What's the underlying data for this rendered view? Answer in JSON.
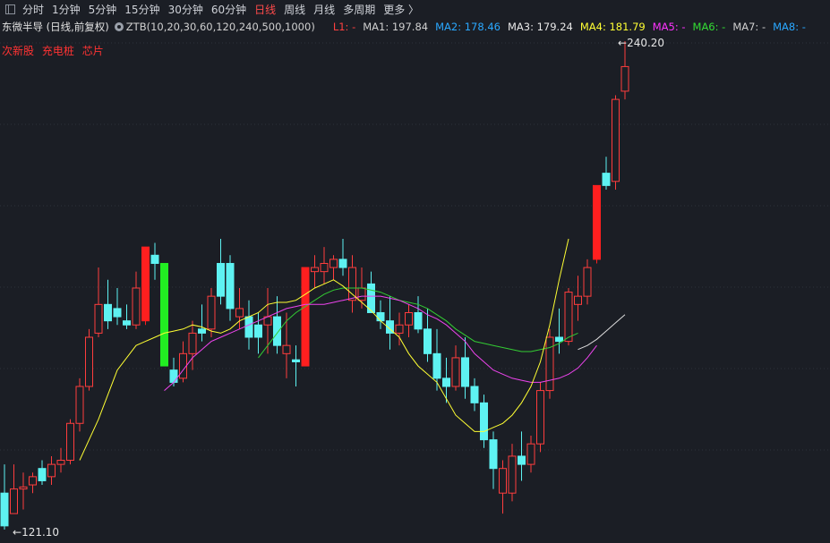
{
  "toolbar": {
    "tabs": [
      "分时",
      "1分钟",
      "5分钟",
      "15分钟",
      "30分钟",
      "60分钟",
      "日线",
      "周线",
      "月线",
      "多周期",
      "更多 〉"
    ],
    "active_index": 6
  },
  "info": {
    "stock_name": "东微半导 (日线,前复权)",
    "indicator": "ZTB(10,20,30,60,120,240,500,1000)",
    "ma_items": [
      {
        "label": "L1: -",
        "color": "#ff4040"
      },
      {
        "label": "MA1: 197.84",
        "color": "#cfcfcf"
      },
      {
        "label": "MA2: 178.46",
        "color": "#2aa8ff"
      },
      {
        "label": "MA3: 179.24",
        "color": "#e8e8e8"
      },
      {
        "label": "MA4: 181.79",
        "color": "#ffff33"
      },
      {
        "label": "MA5: -",
        "color": "#ff33ff"
      },
      {
        "label": "MA6: -",
        "color": "#33dd33"
      },
      {
        "label": "MA7: -",
        "color": "#cfcfcf"
      },
      {
        "label": "MA8: -",
        "color": "#2aa8ff"
      }
    ]
  },
  "tags": [
    "次新股",
    "充电桩",
    "芯片"
  ],
  "high_label": "240.20",
  "low_label": "121.10",
  "colors": {
    "up": "#ff3d3d",
    "down": "#5ef2f2",
    "limit_up": "#ff1f1f",
    "limit_down": "#22ee22",
    "ma_yellow": "#ffff33",
    "ma_magenta": "#ee44ee",
    "ma_green": "#33cc33",
    "ma_white": "#dddddd",
    "grid": "#2c313b"
  },
  "chart_data": {
    "type": "candlestick",
    "price_range": [
      121.1,
      240.2
    ],
    "candles": [
      {
        "o": 130.0,
        "h": 137.0,
        "l": 121.1,
        "c": 122.0,
        "t": "down"
      },
      {
        "o": 125.0,
        "h": 137.0,
        "l": 125.0,
        "c": 131.0,
        "t": "up"
      },
      {
        "o": 131.0,
        "h": 135.0,
        "l": 126.0,
        "c": 131.5,
        "t": "up"
      },
      {
        "o": 132.0,
        "h": 135.0,
        "l": 130.0,
        "c": 134.0,
        "t": "up"
      },
      {
        "o": 133.0,
        "h": 138.0,
        "l": 132.0,
        "c": 136.0,
        "t": "down"
      },
      {
        "o": 134.0,
        "h": 139.0,
        "l": 132.0,
        "c": 137.0,
        "t": "up"
      },
      {
        "o": 137.0,
        "h": 141.0,
        "l": 135.0,
        "c": 138.0,
        "t": "up"
      },
      {
        "o": 138.0,
        "h": 148.0,
        "l": 137.0,
        "c": 147.0,
        "t": "up"
      },
      {
        "o": 147.0,
        "h": 158.0,
        "l": 145.0,
        "c": 156.0,
        "t": "up"
      },
      {
        "o": 156.0,
        "h": 170.0,
        "l": 155.0,
        "c": 168.0,
        "t": "up"
      },
      {
        "o": 169.0,
        "h": 185.0,
        "l": 168.0,
        "c": 176.0,
        "t": "up"
      },
      {
        "o": 176.0,
        "h": 182.0,
        "l": 170.0,
        "c": 172.0,
        "t": "down"
      },
      {
        "o": 175.0,
        "h": 180.0,
        "l": 171.0,
        "c": 173.0,
        "t": "down"
      },
      {
        "o": 172.0,
        "h": 176.0,
        "l": 170.0,
        "c": 171.0,
        "t": "down"
      },
      {
        "o": 171.0,
        "h": 184.0,
        "l": 170.0,
        "c": 180.0,
        "t": "up"
      },
      {
        "o": 172.0,
        "h": 190.0,
        "l": 171.0,
        "c": 190.0,
        "t": "limit_up"
      },
      {
        "o": 188.0,
        "h": 191.0,
        "l": 182.0,
        "c": 186.0,
        "t": "down"
      },
      {
        "o": 186.0,
        "h": 186.0,
        "l": 161.0,
        "c": 161.0,
        "t": "limit_down"
      },
      {
        "o": 160.0,
        "h": 163.0,
        "l": 156.0,
        "c": 157.0,
        "t": "down"
      },
      {
        "o": 158.0,
        "h": 167.0,
        "l": 157.0,
        "c": 164.0,
        "t": "up"
      },
      {
        "o": 164.0,
        "h": 172.0,
        "l": 160.0,
        "c": 169.0,
        "t": "up"
      },
      {
        "o": 169.0,
        "h": 176.0,
        "l": 167.0,
        "c": 170.0,
        "t": "down"
      },
      {
        "o": 170.0,
        "h": 180.0,
        "l": 168.0,
        "c": 178.0,
        "t": "up"
      },
      {
        "o": 178.0,
        "h": 192.0,
        "l": 176.0,
        "c": 186.0,
        "t": "down"
      },
      {
        "o": 186.0,
        "h": 188.0,
        "l": 172.0,
        "c": 175.0,
        "t": "down"
      },
      {
        "o": 175.0,
        "h": 180.0,
        "l": 170.0,
        "c": 173.0,
        "t": "up"
      },
      {
        "o": 173.0,
        "h": 177.0,
        "l": 165.0,
        "c": 168.0,
        "t": "down"
      },
      {
        "o": 168.0,
        "h": 174.0,
        "l": 164.0,
        "c": 171.0,
        "t": "down"
      },
      {
        "o": 171.0,
        "h": 180.0,
        "l": 164.0,
        "c": 173.0,
        "t": "up"
      },
      {
        "o": 173.0,
        "h": 178.0,
        "l": 164.0,
        "c": 166.0,
        "t": "down"
      },
      {
        "o": 166.0,
        "h": 174.0,
        "l": 158.0,
        "c": 164.0,
        "t": "up"
      },
      {
        "o": 162.0,
        "h": 166.0,
        "l": 156.0,
        "c": 162.5,
        "t": "down"
      },
      {
        "o": 161.0,
        "h": 185.0,
        "l": 161.0,
        "c": 185.0,
        "t": "limit_up"
      },
      {
        "o": 184.0,
        "h": 188.0,
        "l": 180.0,
        "c": 185.0,
        "t": "up"
      },
      {
        "o": 184.0,
        "h": 190.0,
        "l": 181.0,
        "c": 186.0,
        "t": "up"
      },
      {
        "o": 185.0,
        "h": 188.0,
        "l": 182.0,
        "c": 187.0,
        "t": "up"
      },
      {
        "o": 187.0,
        "h": 192.0,
        "l": 183.0,
        "c": 185.0,
        "t": "down"
      },
      {
        "o": 185.0,
        "h": 188.0,
        "l": 174.0,
        "c": 177.0,
        "t": "up"
      },
      {
        "o": 177.0,
        "h": 185.0,
        "l": 175.0,
        "c": 180.0,
        "t": "up"
      },
      {
        "o": 181.0,
        "h": 184.0,
        "l": 178.0,
        "c": 174.0,
        "t": "down"
      },
      {
        "o": 174.0,
        "h": 177.0,
        "l": 170.0,
        "c": 172.0,
        "t": "down"
      },
      {
        "o": 172.0,
        "h": 178.0,
        "l": 165.0,
        "c": 169.0,
        "t": "down"
      },
      {
        "o": 169.0,
        "h": 174.0,
        "l": 166.0,
        "c": 171.0,
        "t": "up"
      },
      {
        "o": 171.0,
        "h": 176.0,
        "l": 168.0,
        "c": 174.0,
        "t": "up"
      },
      {
        "o": 174.0,
        "h": 178.0,
        "l": 169.0,
        "c": 170.0,
        "t": "down"
      },
      {
        "o": 170.0,
        "h": 175.0,
        "l": 162.0,
        "c": 164.0,
        "t": "down"
      },
      {
        "o": 164.0,
        "h": 170.0,
        "l": 155.0,
        "c": 158.0,
        "t": "down"
      },
      {
        "o": 158.0,
        "h": 163.0,
        "l": 152.0,
        "c": 156.0,
        "t": "down"
      },
      {
        "o": 156.0,
        "h": 166.0,
        "l": 155.0,
        "c": 163.0,
        "t": "up"
      },
      {
        "o": 163.0,
        "h": 168.0,
        "l": 153.0,
        "c": 156.0,
        "t": "down"
      },
      {
        "o": 156.0,
        "h": 158.0,
        "l": 150.0,
        "c": 152.0,
        "t": "down"
      },
      {
        "o": 152.0,
        "h": 154.0,
        "l": 141.0,
        "c": 143.0,
        "t": "down"
      },
      {
        "o": 143.0,
        "h": 145.0,
        "l": 131.0,
        "c": 136.0,
        "t": "down"
      },
      {
        "o": 136.0,
        "h": 138.0,
        "l": 125.0,
        "c": 130.0,
        "t": "up"
      },
      {
        "o": 130.0,
        "h": 142.0,
        "l": 128.0,
        "c": 139.0,
        "t": "up"
      },
      {
        "o": 139.0,
        "h": 145.0,
        "l": 133.0,
        "c": 137.0,
        "t": "down"
      },
      {
        "o": 137.0,
        "h": 144.0,
        "l": 135.0,
        "c": 142.0,
        "t": "up"
      },
      {
        "o": 142.0,
        "h": 157.0,
        "l": 140.0,
        "c": 155.0,
        "t": "up"
      },
      {
        "o": 155.0,
        "h": 170.0,
        "l": 153.0,
        "c": 168.0,
        "t": "up"
      },
      {
        "o": 168.0,
        "h": 175.0,
        "l": 164.0,
        "c": 167.0,
        "t": "down"
      },
      {
        "o": 167.0,
        "h": 180.0,
        "l": 166.0,
        "c": 179.0,
        "t": "up"
      },
      {
        "o": 176.0,
        "h": 183.0,
        "l": 172.0,
        "c": 178.0,
        "t": "up"
      },
      {
        "o": 178.0,
        "h": 187.0,
        "l": 176.0,
        "c": 185.0,
        "t": "up"
      },
      {
        "o": 187.0,
        "h": 205.0,
        "l": 186.0,
        "c": 205.0,
        "t": "limit_up"
      },
      {
        "o": 208.0,
        "h": 212.0,
        "l": 204.0,
        "c": 205.0,
        "t": "down"
      },
      {
        "o": 206.0,
        "h": 227.0,
        "l": 204.0,
        "c": 226.0,
        "t": "up"
      },
      {
        "o": 228.0,
        "h": 240.2,
        "l": 226.0,
        "c": 234.0,
        "t": "up"
      }
    ],
    "ma_yellow_start": 8,
    "ma_yellow": [
      138.0,
      143.0,
      148.0,
      154.0,
      160.0,
      163.0,
      166.0,
      167.0,
      168.0,
      169.0,
      169.5,
      170.0,
      171.0,
      170.5,
      169.5,
      169.0,
      170.0,
      172.0,
      173.0,
      174.0,
      176.0,
      176.5,
      176.5,
      177.0,
      178.5,
      180.0,
      181.0,
      182.0,
      180.5,
      178.5,
      176.5,
      174.5,
      172.0,
      170.0,
      168.0,
      164.0,
      161.0,
      159.0,
      157.0,
      153.0,
      149.0,
      147.0,
      145.0,
      145.0,
      146.0,
      147.0,
      149.0,
      152.0,
      156.0,
      162.0,
      171.0,
      182.0,
      192.0
    ],
    "ma_magenta_start": 17,
    "ma_magenta": [
      155.0,
      157.0,
      160.0,
      163.0,
      165.0,
      167.0,
      168.0,
      169.0,
      170.0,
      171.0,
      172.0,
      173.0,
      174.0,
      175.0,
      175.5,
      176.0,
      176.0,
      176.0,
      176.5,
      177.0,
      177.5,
      178.0,
      178.0,
      178.0,
      177.5,
      177.0,
      176.0,
      175.0,
      173.5,
      172.5,
      171.0,
      169.0,
      167.0,
      164.0,
      162.0,
      160.0,
      159.0,
      158.0,
      157.5,
      157.0,
      157.0,
      157.5,
      158.0,
      159.0,
      160.5,
      163.0,
      166.0
    ],
    "ma_green_start": 27,
    "ma_green": [
      163.0,
      166.0,
      169.0,
      172.0,
      174.0,
      175.5,
      177.0,
      178.5,
      179.5,
      180.0,
      180.0,
      180.0,
      179.5,
      179.0,
      178.0,
      177.0,
      176.5,
      176.0,
      175.0,
      173.5,
      172.0,
      170.0,
      168.5,
      167.0,
      166.5,
      166.0,
      165.5,
      165.0,
      164.5,
      164.5,
      165.0,
      165.5,
      166.5,
      168.0,
      169.0
    ],
    "ma_white_start": 61,
    "ma_white": [
      165.0,
      166.0,
      167.5,
      169.5,
      171.5,
      173.5
    ]
  }
}
